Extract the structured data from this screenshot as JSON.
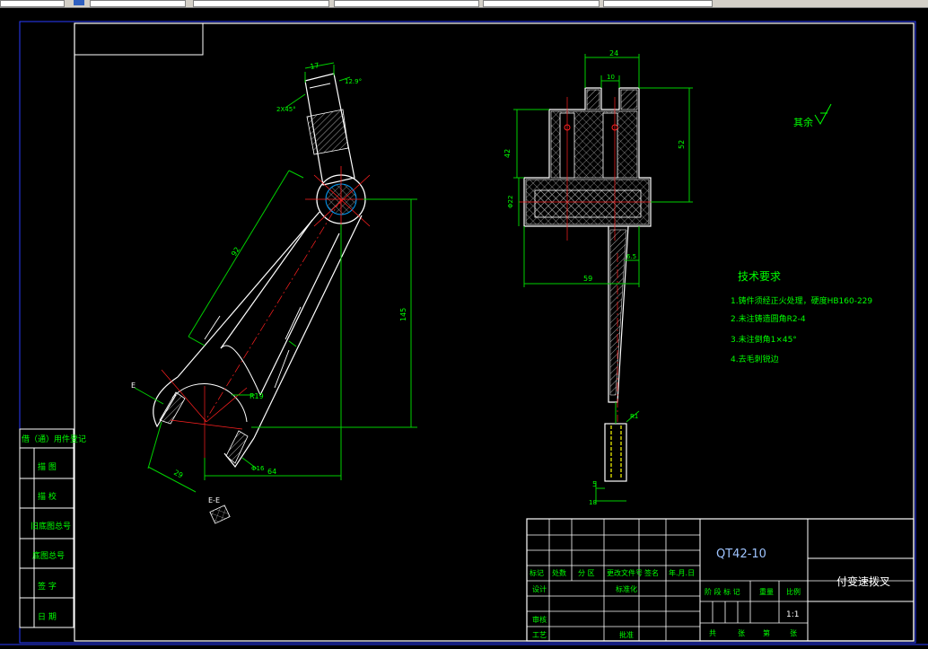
{
  "toolbar": {
    "bg": "#d4d0c8"
  },
  "title_block": {
    "part_code": "QT42-10",
    "part_name": "付变速拨叉",
    "scale": "1:1",
    "header_row": [
      "标记",
      "处数",
      "分 区",
      "更改文件号",
      "签名",
      "年.月.日"
    ],
    "row_design": [
      "设计",
      "标准化"
    ],
    "row_review": [
      "审核"
    ],
    "row_process": [
      "工艺",
      "批准"
    ],
    "stage_cols": [
      "阶 段 标 记",
      "重量",
      "比例"
    ],
    "footer_cols": [
      "共",
      "张",
      "第",
      "张"
    ]
  },
  "left_strip": [
    "借（通）用件登记",
    "描 图",
    "描 校",
    "旧底图总号",
    "底图总号",
    "签 字",
    "日 期"
  ],
  "tech": {
    "title": "技术要求",
    "items": [
      "1.铸件须经正火处理，硬度HB160-229",
      "2.未注铸造圆角R2-4",
      "3.未注倒角1×45°",
      "4.去毛刺锐边"
    ]
  },
  "surface_note": "其余",
  "dims_left": {
    "d17": "17",
    "d12": "12.9°",
    "chamfer": "2X45°",
    "d92": "92",
    "d145": "145",
    "r19": "R19",
    "d64": "64",
    "phi6": "Φ16",
    "d29": "29",
    "e_label": "E",
    "section": "E-E"
  },
  "dims_right": {
    "d24": "24",
    "d10": "10",
    "d42": "42",
    "d52": "52",
    "phi22": "Φ22",
    "d59": "59",
    "d65": "6.5",
    "r1": "R1",
    "d5": "5",
    "d18": "18"
  }
}
